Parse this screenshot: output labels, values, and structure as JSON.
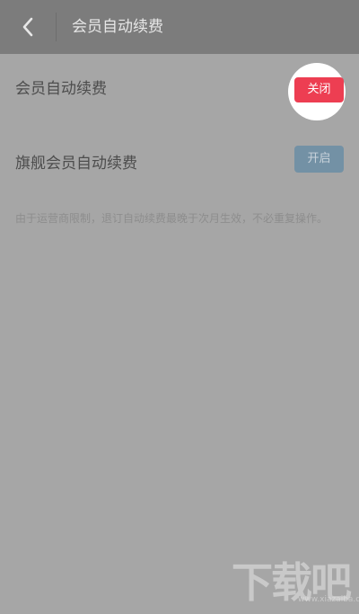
{
  "header": {
    "title": "会员自动续费",
    "back_icon": "chevron-left-icon"
  },
  "rows": [
    {
      "label": "会员自动续费",
      "button_label": "关闭",
      "button_color": "#ed3e52"
    },
    {
      "label": "旗舰会员自动续费",
      "button_label": "开启",
      "button_color": "#7391a5"
    }
  ],
  "note": "由于运营商限制，退订自动续费最晚于次月生效，不必重复操作。",
  "watermark": {
    "text": "下载吧",
    "url": "www.xiazaiba.com"
  },
  "colors": {
    "header_bg": "#7c7c7c",
    "page_bg": "#a6a6a6"
  }
}
